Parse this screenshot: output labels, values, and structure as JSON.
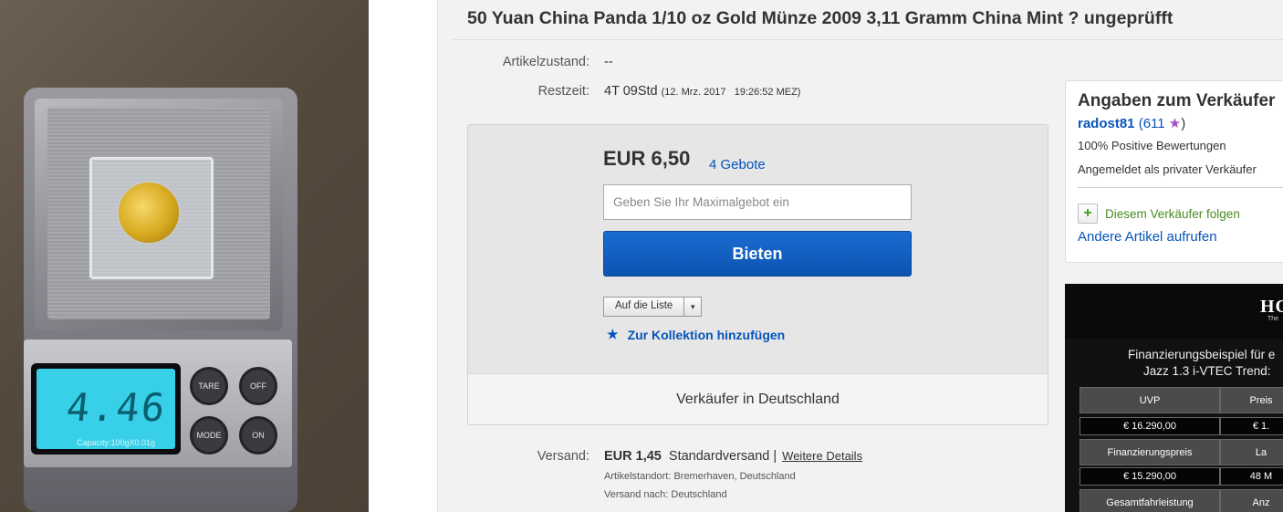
{
  "photo": {
    "display_value": "4.46",
    "capacity": "Capacity:100gX0.01g",
    "keys": [
      "TARE",
      "OFF",
      "MODE",
      "ON"
    ]
  },
  "title": "50 Yuan China Panda 1/10 oz Gold Münze 2009 3,11 Gramm China Mint ? ungeprüfft",
  "details": {
    "condition_label": "Artikelzustand:",
    "condition_value": "--",
    "time_label": "Restzeit:",
    "time_value": "4T 09Std",
    "time_end": "(12. Mrz. 2017   19:26:52 MEZ)"
  },
  "bid": {
    "price": "EUR 6,50",
    "bids_link": "4 Gebote",
    "max_placeholder": "Geben Sie Ihr Maximalgebot ein",
    "button": "Bieten",
    "watch_label": "Auf die Liste",
    "watch_caret": "▾",
    "collection_link": "Zur Kollektion hinzufügen",
    "seller_location": "Verkäufer in Deutschland"
  },
  "shipping": {
    "label": "Versand:",
    "price": "EUR 1,45",
    "method": "Standardversand |",
    "details_link": "Weitere Details",
    "location_label": "Artikelstandort:",
    "location_value": "Bremerhaven, Deutschland",
    "ships_to_label": "Versand nach:",
    "ships_to_value": "Deutschland"
  },
  "seller": {
    "heading": "Angaben zum Verkäufer",
    "name": "radost81",
    "open_paren": "(",
    "feedback_count": "611",
    "star": "★",
    "close_paren": ")",
    "positive": "100% Positive Bewertungen",
    "type": "Angemeldet als privater Verkäufer",
    "follow_icon": "+",
    "follow": "Diesem Verkäufer folgen",
    "other_items": "Andere Artikel aufrufen"
  },
  "ad": {
    "logo": "HO",
    "logo_sub": "The",
    "line1": "Finanzierungsbeispiel für e",
    "line2": "Jazz 1.3 i-VTEC Trend:",
    "rows": [
      {
        "left": "UVP",
        "right": "Preis"
      },
      {
        "left": "€ 16.290,00",
        "right": "€ 1."
      },
      {
        "left": "Finanzierungspreis",
        "right": "La"
      },
      {
        "left": "€ 15.290,00",
        "right": "48 M"
      },
      {
        "left": "Gesamtfahrleistung",
        "right": "Anz"
      }
    ]
  },
  "colors": {
    "link": "#0654ba",
    "bid_button": "#0c54b0",
    "follow_green": "#4a8a22",
    "star_purple": "#a34ec5"
  }
}
